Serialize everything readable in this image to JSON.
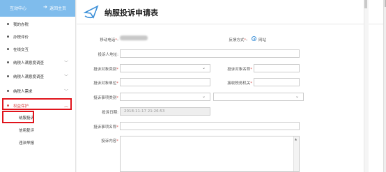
{
  "sidebar": {
    "header_title": "互动中心",
    "back_label": "返回主页",
    "items": [
      {
        "label": "我的办税",
        "chevron": ""
      },
      {
        "label": "办税评价",
        "chevron": ""
      },
      {
        "label": "在线交互",
        "chevron": ""
      },
      {
        "label": "纳税人满意度调查",
        "chevron": "﹀"
      },
      {
        "label": "纳税人满意度调查",
        "chevron": "﹀"
      },
      {
        "label": "纳税人需求",
        "chevron": "﹀"
      },
      {
        "label": "权益保护",
        "chevron": "︿"
      }
    ],
    "sub_items": [
      "纳服投诉",
      "信用复评",
      "违法举报"
    ]
  },
  "form": {
    "title": "纳服投诉申请表",
    "mobile_label": "移动电话",
    "feedback_label": "反馈方式",
    "feedback_option": "网站",
    "address_label": "投诉人地址",
    "target_type_label": "投诉对象类别",
    "target_name_label": "投诉对象名称",
    "target_unit_label": "投诉对象单位",
    "tax_office_label": "接收税务机关",
    "matter_type_label": "投诉事项类别",
    "date_label": "投诉日期",
    "date_value": "2018-11-17 21:26:53",
    "matter_name_label": "投诉事项名称",
    "content_label": "投诉内容",
    "required_mark": "*",
    "colon": ":"
  },
  "colors": {
    "accent": "#3b8fd8",
    "highlight": "#e0141c",
    "required": "#d9534f",
    "sidebar_header": "#7fbcec"
  }
}
